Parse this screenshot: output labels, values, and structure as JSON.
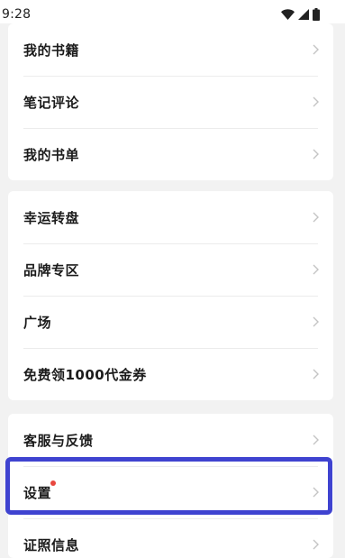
{
  "status_bar": {
    "time": "9:28",
    "icons": [
      "wifi-icon",
      "signal-icon",
      "battery-icon"
    ]
  },
  "menu_group_1": [
    {
      "label": "我的书籍"
    },
    {
      "label": "笔记评论"
    },
    {
      "label": "我的书单"
    }
  ],
  "menu_group_2": [
    {
      "label": "幸运转盘"
    },
    {
      "label": "品牌专区"
    },
    {
      "label": "广场"
    },
    {
      "label": "免费领1000代金券"
    }
  ],
  "menu_group_3": [
    {
      "label": "客服与反馈"
    },
    {
      "label": "设置",
      "badge": "red-dot"
    },
    {
      "label": "证照信息"
    }
  ],
  "colors": {
    "highlight": "#3f43d0",
    "badge_dot": "#e8473f",
    "chevron": "#c4c4c4"
  }
}
